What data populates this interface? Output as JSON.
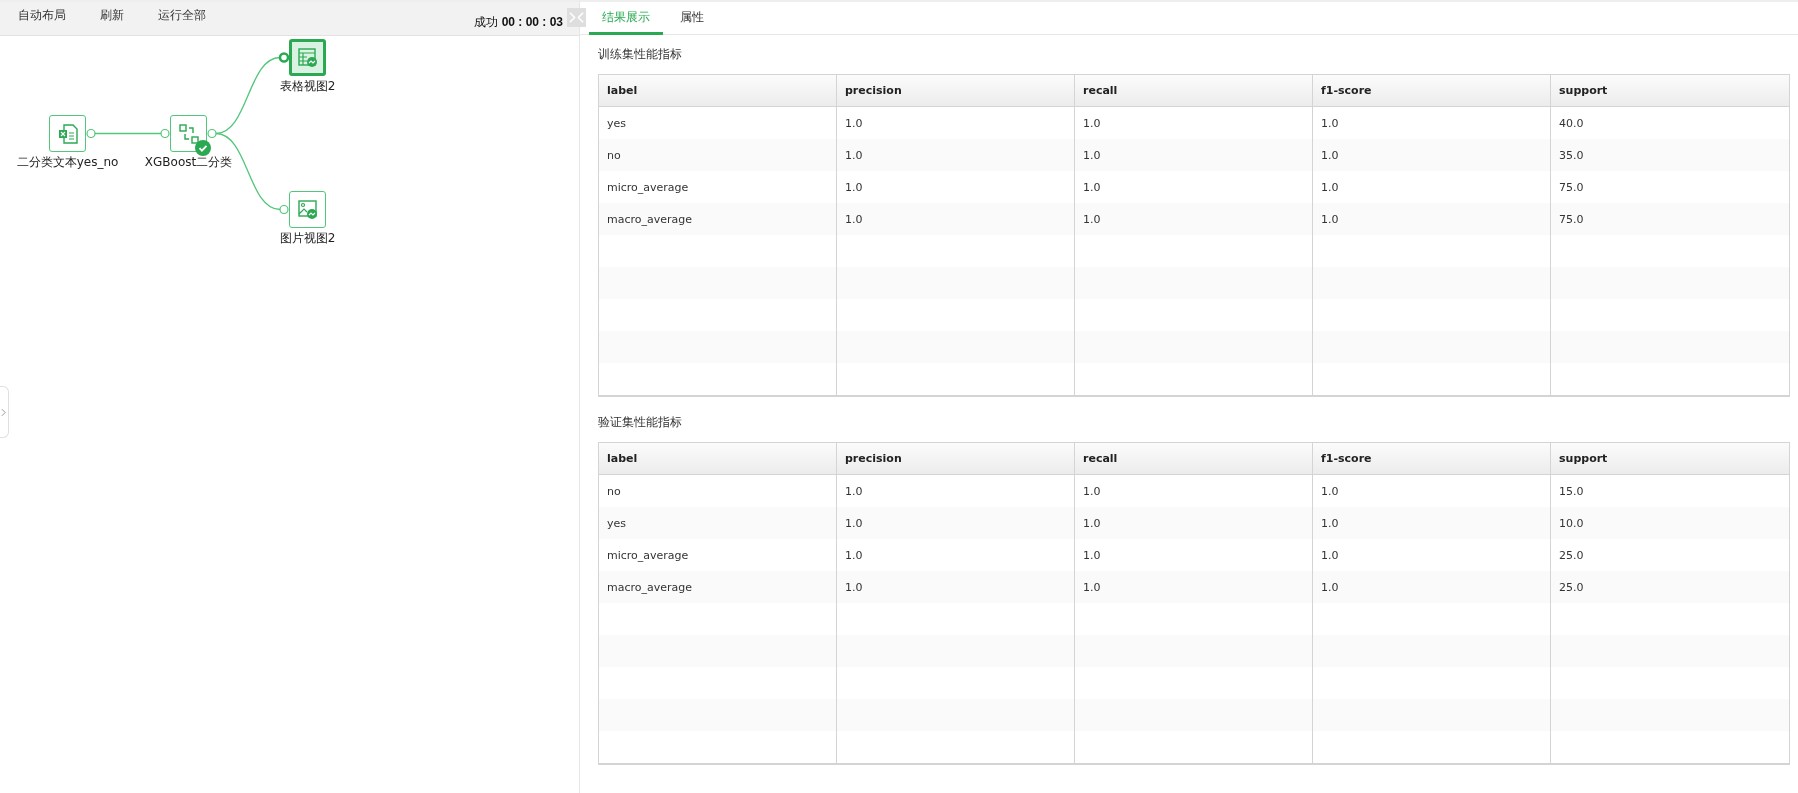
{
  "toolbar": {
    "buttons": [
      "自动布局",
      "刷新",
      "运行全部"
    ],
    "status_label": "成功",
    "elapsed": "00 : 00 : 03"
  },
  "nodes": [
    {
      "label": "二分类文本yes_no",
      "kind": "excel",
      "selected": false,
      "completed": false
    },
    {
      "label": "XGBoost二分类",
      "kind": "model",
      "selected": false,
      "completed": true
    },
    {
      "label": "表格视图2",
      "kind": "table",
      "selected": true,
      "completed": false
    },
    {
      "label": "图片视图2",
      "kind": "image",
      "selected": false,
      "completed": false
    }
  ],
  "tabs": [
    {
      "label": "结果展示",
      "selected": true
    },
    {
      "label": "属性",
      "selected": false
    }
  ],
  "sections": [
    {
      "title": "训练集性能指标",
      "columns": [
        "label",
        "precision",
        "recall",
        "f1-score",
        "support"
      ],
      "rows": [
        [
          "yes",
          "1.0",
          "1.0",
          "1.0",
          "40.0"
        ],
        [
          "no",
          "1.0",
          "1.0",
          "1.0",
          "35.0"
        ],
        [
          "micro_average",
          "1.0",
          "1.0",
          "1.0",
          "75.0"
        ],
        [
          "macro_average",
          "1.0",
          "1.0",
          "1.0",
          "75.0"
        ]
      ]
    },
    {
      "title": "验证集性能指标",
      "columns": [
        "label",
        "precision",
        "recall",
        "f1-score",
        "support"
      ],
      "rows": [
        [
          "no",
          "1.0",
          "1.0",
          "1.0",
          "15.0"
        ],
        [
          "yes",
          "1.0",
          "1.0",
          "1.0",
          "10.0"
        ],
        [
          "micro_average",
          "1.0",
          "1.0",
          "1.0",
          "25.0"
        ],
        [
          "macro_average",
          "1.0",
          "1.0",
          "1.0",
          "25.0"
        ]
      ]
    }
  ]
}
